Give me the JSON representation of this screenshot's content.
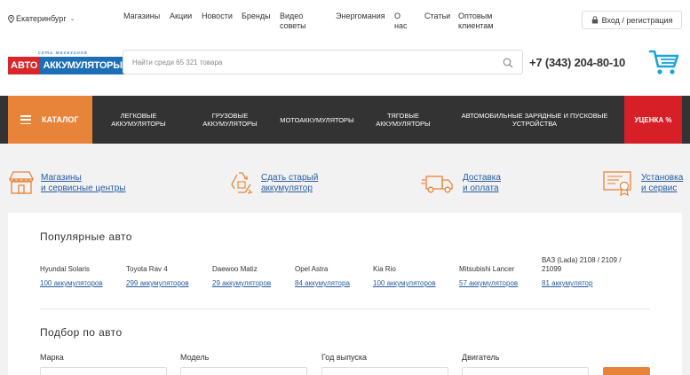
{
  "topbar": {
    "city": "Екатеринбург",
    "nav": [
      {
        "label": "Магазины"
      },
      {
        "label": "Акции"
      },
      {
        "label": "Новости"
      },
      {
        "label": "Бренды"
      },
      {
        "label": "Видео советы"
      },
      {
        "label": "Энергомания"
      },
      {
        "label": "О нас"
      },
      {
        "label": "Статьи"
      },
      {
        "label": "Оптовым клиентам"
      }
    ],
    "login": "Вход / регистрация"
  },
  "header": {
    "logo_top": "сеть магазинов",
    "logo_left": "АВТО",
    "logo_right": "АККУМУЛЯТОРЫ",
    "search_placeholder": "Найти среди 65 321 товара",
    "phone": "+7 (343) 204-80-10"
  },
  "catbar": {
    "catalog": "КАТАЛОГ",
    "items": [
      {
        "label": "ЛЕГКОВЫЕ АККУМУЛЯТОРЫ"
      },
      {
        "label": "ГРУЗОВЫЕ АККУМУЛЯТОРЫ"
      },
      {
        "label": "МОТОАККУМУЛЯТОРЫ"
      },
      {
        "label": "ТЯГОВЫЕ АККУМУЛЯТОРЫ"
      },
      {
        "label": "АВТОМОБИЛЬНЫЕ ЗАРЯДНЫЕ И ПУСКОВЫЕ УСТРОЙСТВА"
      }
    ],
    "sale": "УЦЕНКА %"
  },
  "features": [
    {
      "line1": "Магазины",
      "line2": "и сервисные центры",
      "icon": "store-icon"
    },
    {
      "line1": "Сдать старый",
      "line2": "аккумулятор",
      "icon": "recycle-icon"
    },
    {
      "line1": "Доставка",
      "line2": "и оплата",
      "icon": "truck-icon"
    },
    {
      "line1": "Установка",
      "line2": "и сервис",
      "icon": "certificate-icon"
    }
  ],
  "popular": {
    "title": "Популярные авто",
    "cars": [
      {
        "name": "Hyundai Solaris",
        "link": "100 аккумуляторов"
      },
      {
        "name": "Toyota Rav 4",
        "link": "299 аккумуляторов"
      },
      {
        "name": "Daewoo Matiz",
        "link": "29 аккумуляторов"
      },
      {
        "name": "Opel Astra",
        "link": "84 аккумулятора"
      },
      {
        "name": "Kia Rio",
        "link": "100 аккумуляторов"
      },
      {
        "name": "Mitsubishi Lancer",
        "link": "57 аккумуляторов"
      },
      {
        "name": "ВАЗ (Lada) 2108 / 2109 / 21099",
        "link": "81 аккумулятор"
      }
    ]
  },
  "selector": {
    "title": "Подбор по авто",
    "fields": [
      {
        "label": "Марка"
      },
      {
        "label": "Модель"
      },
      {
        "label": "Год выпуска"
      },
      {
        "label": "Двигатель"
      }
    ]
  },
  "colors": {
    "accent": "#e8843a",
    "sale": "#d61f26",
    "link": "#2a5d9f",
    "catbar": "#333333"
  }
}
